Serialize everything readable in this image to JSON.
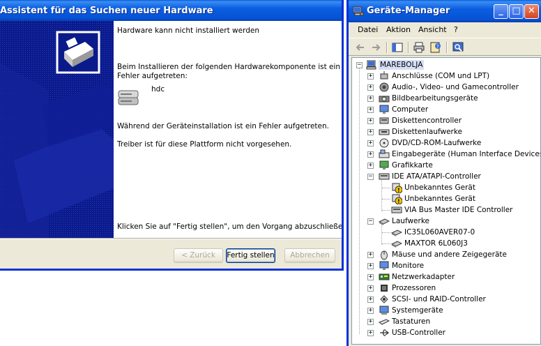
{
  "wizard": {
    "title": "Assistent für das Suchen neuer Hardware",
    "heading": "Hardware kann nicht installiert werden",
    "intro_line1": "Beim Installieren der folgenden Hardwarekomponente ist ein",
    "intro_line2": "Fehler aufgetreten:",
    "device_name": "hdc",
    "error_text": "Während der Geräteinstallation ist ein Fehler aufgetreten.",
    "detail_text": "Treiber ist für diese Plattform nicht vorgesehen.",
    "finish_hint": "Klicken Sie auf \"Fertig stellen\", um den Vorgang abzuschließen.",
    "buttons": {
      "back": "< Zurück",
      "finish": "Fertig stellen",
      "cancel": "Abbrechen"
    }
  },
  "device_manager": {
    "title": "Geräte-Manager",
    "menu": [
      "Datei",
      "Aktion",
      "Ansicht",
      "?"
    ],
    "root": "MAREBOLJA",
    "nodes": [
      "Anschlüsse (COM und LPT)",
      "Audio-, Video- und Gamecontroller",
      "Bildbearbeitungsgeräte",
      "Computer",
      "Diskettencontroller",
      "Diskettenlaufwerke",
      "DVD/CD-ROM-Laufwerke",
      "Eingabegeräte (Human Interface Devices)",
      "Grafikkarte",
      "IDE ATA/ATAPI-Controller",
      "Unbekanntes Gerät",
      "Unbekanntes Gerät",
      "VIA Bus Master IDE Controller",
      "Laufwerke",
      "IC35L060AVER07-0",
      "MAXTOR 6L060J3",
      "Mäuse und andere Zeigegeräte",
      "Monitore",
      "Netzwerkadapter",
      "Prozessoren",
      "SCSI- und RAID-Controller",
      "Systemgeräte",
      "Tastaturen",
      "USB-Controller"
    ]
  }
}
